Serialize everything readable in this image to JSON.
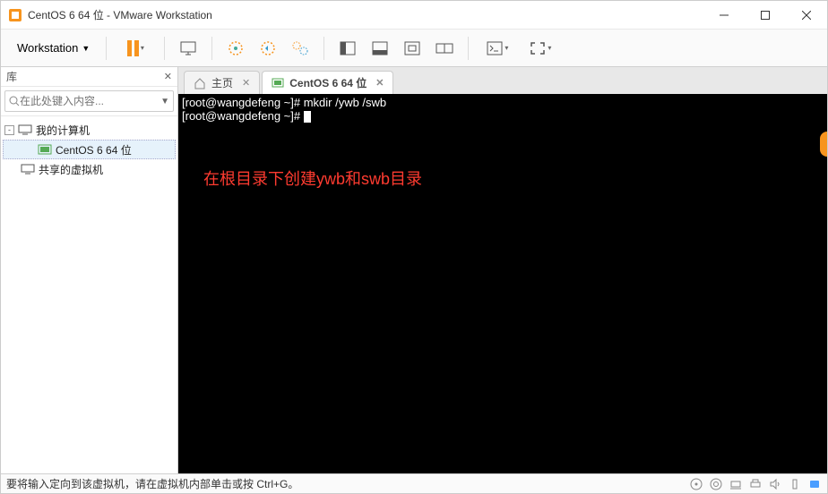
{
  "window": {
    "title": "CentOS 6 64 位 - VMware Workstation"
  },
  "menu": {
    "workstation": "Workstation"
  },
  "sidebar": {
    "header": "库",
    "search_placeholder": "在此处键入内容...",
    "items": [
      {
        "label": "我的计算机",
        "depth": 1,
        "expander": "-"
      },
      {
        "label": "CentOS 6 64 位",
        "depth": 2,
        "selected": true
      },
      {
        "label": "共享的虚拟机",
        "depth": 2
      }
    ]
  },
  "tabs": {
    "home": "主页",
    "vm": "CentOS 6 64 位"
  },
  "terminal": {
    "lines": [
      "[root@wangdefeng ~]# mkdir /ywb /swb",
      "[root@wangdefeng ~]# "
    ],
    "annotation": "在根目录下创建ywb和swb目录"
  },
  "statusbar": {
    "text": "要将输入定向到该虚拟机，请在虚拟机内部单击或按 Ctrl+G。"
  }
}
